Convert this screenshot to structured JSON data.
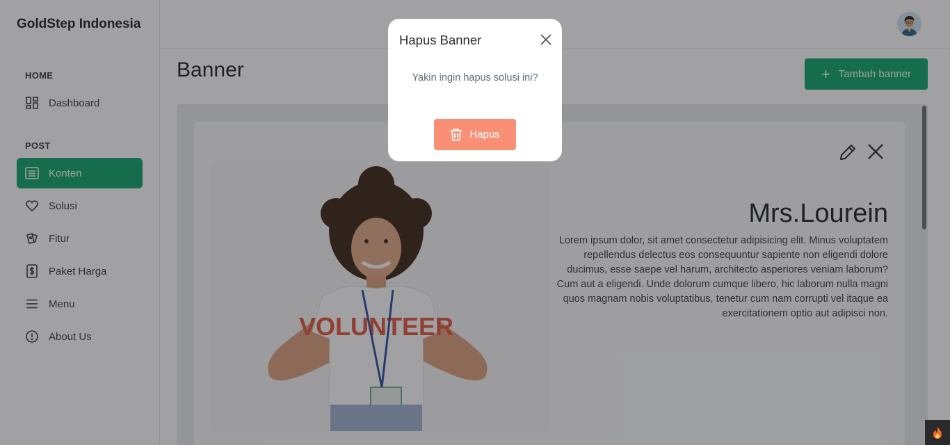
{
  "brand": "GoldStep Indonesia",
  "sidebar": {
    "sections": [
      {
        "label": "HOME"
      },
      {
        "label": "POST"
      }
    ],
    "items": [
      {
        "label": "Dashboard",
        "icon": "dashboard-icon"
      },
      {
        "label": "Konten",
        "icon": "document-icon",
        "active": true
      },
      {
        "label": "Solusi",
        "icon": "heart-icon"
      },
      {
        "label": "Fitur",
        "icon": "cards-icon"
      },
      {
        "label": "Paket Harga",
        "icon": "dollar-icon"
      },
      {
        "label": "Menu",
        "icon": "menu-icon"
      },
      {
        "label": "About Us",
        "icon": "info-icon"
      }
    ]
  },
  "page": {
    "title": "Banner",
    "add_button": "Tambah banner"
  },
  "banner": {
    "title": "Mrs.Lourein",
    "description": "Lorem ipsum dolor, sit amet consectetur adipisicing elit. Minus voluptatem repellendus delectus eos consequuntur sapiente non eligendi dolore ducimus, esse saepe vel harum, architecto asperiores veniam laborum? Cum aut a eligendi. Unde dolorum cumque libero, hic laborum nulla magni quos magnam nobis voluptatibus, tenetur cum nam corrupti vel itaque ea exercitationem optio aut adipisci non.",
    "shirt_text": "VOLUNTEER"
  },
  "modal": {
    "title": "Hapus Banner",
    "message": "Yakin ingin hapus solusi ini?",
    "confirm_label": "Hapus"
  },
  "colors": {
    "primary": "#0ea56b",
    "danger": "#f98f74",
    "overlay": "rgba(30,32,36,0.42)"
  }
}
